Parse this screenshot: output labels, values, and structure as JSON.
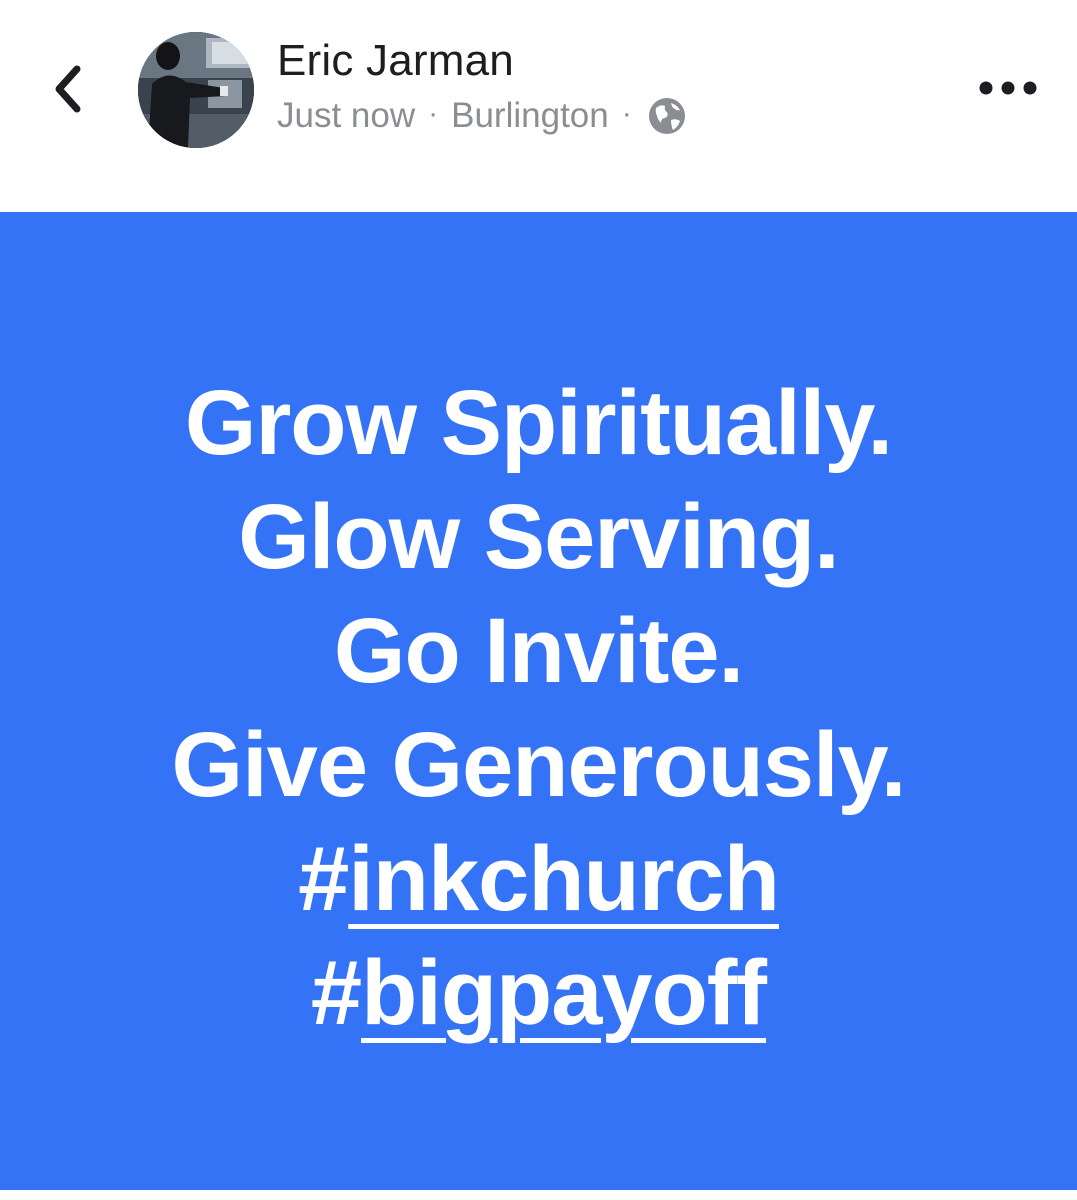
{
  "header": {
    "back_icon": "chevron-left-icon",
    "author_name": "Eric Jarman",
    "timestamp": "Just now",
    "separator": "·",
    "location": "Burlington",
    "audience_icon": "globe-icon",
    "more_icon": "more-horizontal-icon"
  },
  "post": {
    "background_color": "#3472f6",
    "text_color": "#ffffff",
    "lines": [
      "Grow Spiritually.",
      "Glow Serving.",
      "Go Invite.",
      "Give Generously."
    ],
    "hashtags": [
      {
        "prefix": "#",
        "word": "inkchurch"
      },
      {
        "prefix": "#",
        "word": "bigpayoff"
      }
    ]
  }
}
